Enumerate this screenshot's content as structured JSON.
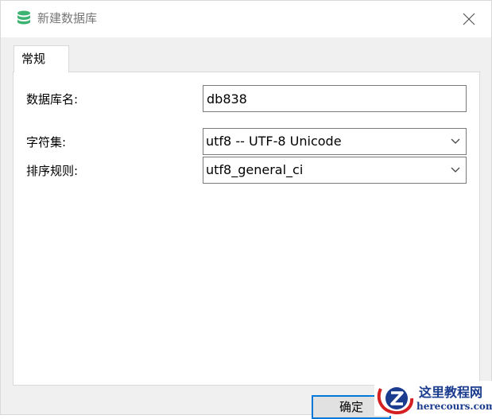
{
  "window": {
    "title": "新建数据库",
    "icon": "database-icon",
    "close_icon": "close-icon"
  },
  "tabs": [
    {
      "label": "常规",
      "active": true
    }
  ],
  "form": {
    "db_name_label": "数据库名:",
    "db_name_value": "db838",
    "charset_label": "字符集:",
    "charset_value": "utf8 -- UTF-8 Unicode",
    "collation_label": "排序规则:",
    "collation_value": "utf8_general_ci"
  },
  "buttons": {
    "ok_label": "确定"
  },
  "watermark": {
    "name": "这里教程网",
    "site": "herecours.com"
  },
  "colors": {
    "accent": "#0078d7",
    "db_icon": "#3cb371",
    "watermark": "#1a3b8e"
  }
}
